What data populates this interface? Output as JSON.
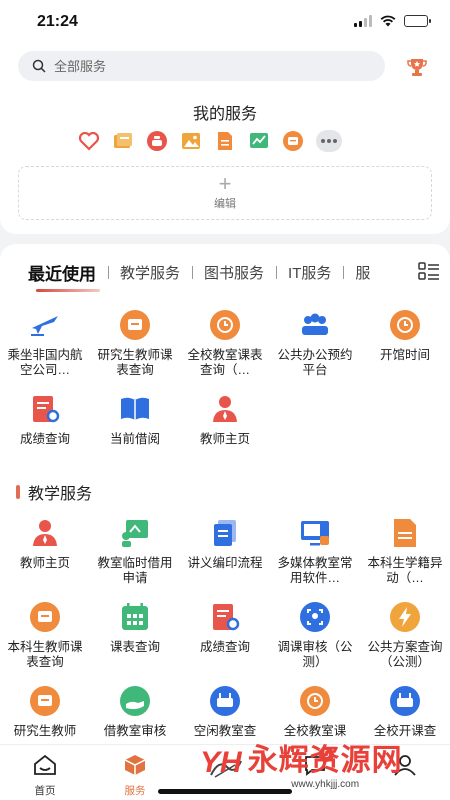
{
  "status": {
    "time": "21:24"
  },
  "search": {
    "placeholder": "全部服务"
  },
  "my_services": {
    "title": "我的服务",
    "icons": [
      "heart-icon",
      "folder-icon",
      "pot-icon",
      "image-icon",
      "document-icon",
      "chart-icon",
      "message-icon",
      "more-icon"
    ],
    "edit_label": "编辑"
  },
  "tabs": [
    "最近使用",
    "教学服务",
    "图书服务",
    "IT服务",
    "服"
  ],
  "recent": [
    {
      "label": "乘坐非国内航空公司…",
      "icon": "airplane-icon",
      "color": "#2f6fe0"
    },
    {
      "label": "研究生教师课表查询",
      "icon": "message-icon",
      "color": "#f08a3c"
    },
    {
      "label": "全校教室课表查询（…",
      "icon": "clock-icon",
      "color": "#f08a3c"
    },
    {
      "label": "公共办公预约平台",
      "icon": "group-icon",
      "color": "#2f6fe0"
    },
    {
      "label": "开馆时间",
      "icon": "clock-icon",
      "color": "#f08a3c"
    },
    {
      "label": "成绩查询",
      "icon": "report-icon",
      "color": "#e8554a"
    },
    {
      "label": "当前借阅",
      "icon": "book-icon",
      "color": "#2f6fe0"
    },
    {
      "label": "教师主页",
      "icon": "teacher-icon",
      "color": "#e8554a"
    }
  ],
  "teaching": {
    "title": "教学服务",
    "items": [
      {
        "label": "教师主页",
        "icon": "teacher-icon",
        "color": "#e8554a"
      },
      {
        "label": "教室临时借用申请",
        "icon": "classroom-icon",
        "color": "#3fb87a"
      },
      {
        "label": "讲义编印流程",
        "icon": "document-icon",
        "color": "#2f6fe0"
      },
      {
        "label": "多媒体教室常用软件…",
        "icon": "monitor-icon",
        "color": "#2f6fe0"
      },
      {
        "label": "本科生学籍异动（…",
        "icon": "file-icon",
        "color": "#f08a3c"
      },
      {
        "label": "本科生教师课表查询",
        "icon": "message-icon",
        "color": "#f08a3c"
      },
      {
        "label": "课表查询",
        "icon": "calendar-icon",
        "color": "#3fb87a"
      },
      {
        "label": "成绩查询",
        "icon": "report-icon",
        "color": "#e8554a"
      },
      {
        "label": "调课审核（公测）",
        "icon": "scan-icon",
        "color": "#2f6fe0"
      },
      {
        "label": "公共方案查询（公测）",
        "icon": "bolt-icon",
        "color": "#f0a43c"
      },
      {
        "label": "研究生教师",
        "icon": "message-icon",
        "color": "#f08a3c"
      },
      {
        "label": "借教室审核",
        "icon": "hand-icon",
        "color": "#3fb87a"
      },
      {
        "label": "空闲教室查",
        "icon": "router-icon",
        "color": "#2f6fe0"
      },
      {
        "label": "全校教室课",
        "icon": "clock-icon",
        "color": "#f08a3c"
      },
      {
        "label": "全校开课查",
        "icon": "router-icon",
        "color": "#2f6fe0"
      }
    ]
  },
  "tabbar": [
    {
      "label": "首页",
      "icon": "home-icon",
      "active": false
    },
    {
      "label": "服务",
      "icon": "box-icon",
      "active": true
    },
    {
      "label": "",
      "icon": "logo-icon",
      "active": false
    },
    {
      "label": "",
      "icon": "message-icon",
      "active": false,
      "badge": "5"
    },
    {
      "label": "",
      "icon": "user-icon",
      "active": false
    }
  ],
  "watermark": {
    "text": "永辉资源网",
    "url": "www.yhkjjj.com"
  }
}
